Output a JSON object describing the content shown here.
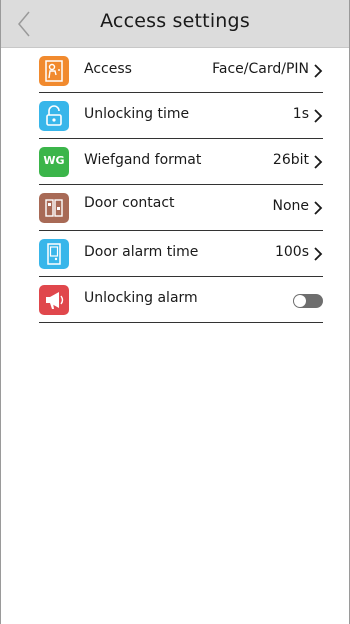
{
  "header": {
    "title": "Access settings",
    "back_icon": "chevron-left-icon"
  },
  "settings": [
    {
      "key": "access",
      "label": "Access",
      "value": "Face/Card/PIN",
      "icon": "person-door-icon",
      "icon_color": "#f18a2e",
      "control": "chevron"
    },
    {
      "key": "unlocking-time",
      "label": "Unlocking time",
      "value": "1s",
      "icon": "unlock-icon",
      "icon_color": "#38b6ea",
      "control": "chevron"
    },
    {
      "key": "wiegand-format",
      "label": "Wiefgand format",
      "value": "26bit",
      "icon": "wg-icon",
      "icon_text": "WG",
      "icon_color": "#3bb54a",
      "control": "chevron"
    },
    {
      "key": "door-contact",
      "label": "Door contact",
      "value": "None",
      "icon": "door-contact-icon",
      "icon_color": "#a86a56",
      "control": "chevron"
    },
    {
      "key": "door-alarm-time",
      "label": "Door alarm time",
      "value": "100s",
      "icon": "door-alarm-icon",
      "icon_color": "#38b6ea",
      "control": "chevron"
    },
    {
      "key": "unlocking-alarm",
      "label": "Unlocking alarm",
      "icon": "megaphone-icon",
      "icon_color": "#e0474c",
      "control": "toggle",
      "toggle_on": false
    }
  ]
}
